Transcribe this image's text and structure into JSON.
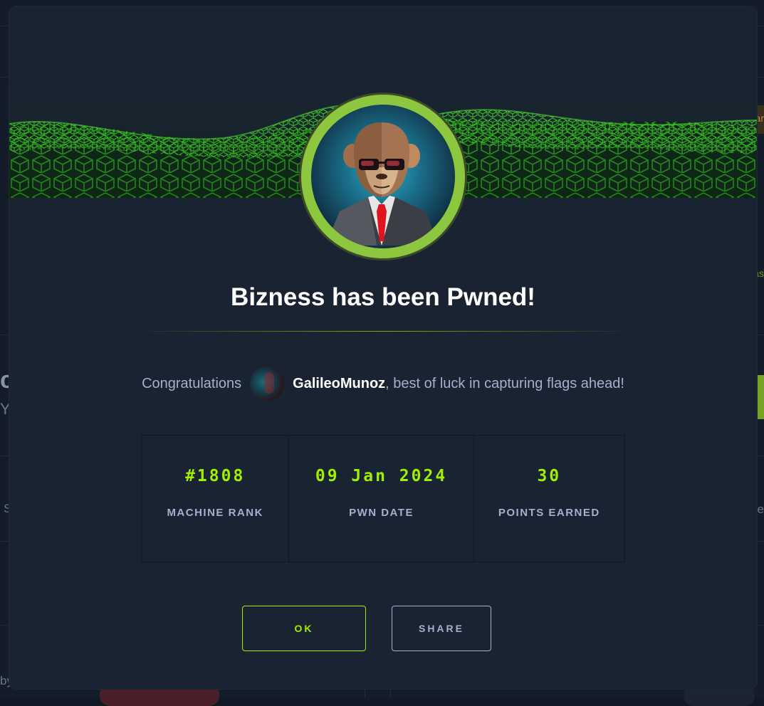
{
  "background": {
    "fragments": [
      "c",
      "Y",
      "S",
      "by",
      "e",
      "ar",
      "as"
    ]
  },
  "modal": {
    "machine_avatar_icon": "suited-monkey-with-sunglasses",
    "title": "Bizness has been Pwned!",
    "congrats": {
      "prefix": "Congratulations",
      "username": "GalileoMunoz",
      "suffix": ", best of luck in capturing flags ahead!"
    },
    "stats": [
      {
        "value": "#1808",
        "label": "MACHINE RANK"
      },
      {
        "value": "09 Jan 2024",
        "label": "PWN DATE"
      },
      {
        "value": "30",
        "label": "POINTS EARNED"
      }
    ],
    "buttons": {
      "ok": "OK",
      "share": "SHARE"
    }
  },
  "colors": {
    "accent": "#9fef00",
    "modal_bg": "#1a2332",
    "text_muted": "#a4b1cd",
    "ring": "#8dc63f"
  }
}
